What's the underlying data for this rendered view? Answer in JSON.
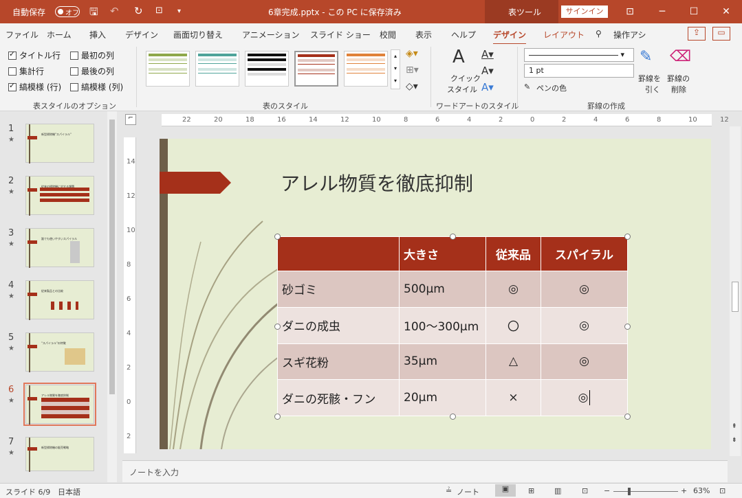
{
  "titlebar": {
    "autosave_label": "自動保存",
    "autosave_state": "オフ",
    "filename": "6章完成.pptx - この PC に保存済み",
    "context_tab_group": "表ツール",
    "signin": "サインイン"
  },
  "tabs": [
    "ファイル",
    "ホーム",
    "挿入",
    "デザイン",
    "画面切り替え",
    "アニメーション",
    "スライド ショー",
    "校閲",
    "表示",
    "ヘルプ",
    "デザイン",
    "レイアウト"
  ],
  "search_label": "操作アシ",
  "ribbon": {
    "options": {
      "header_row": "タイトル行",
      "total_row": "集計行",
      "banded_rows": "縞模様 (行)",
      "first_column": "最初の列",
      "last_column": "最後の列",
      "banded_columns": "縞模様 (列)",
      "group_label": "表スタイルのオプション"
    },
    "styles_group_label": "表のスタイル",
    "wordart": {
      "quick_style_line1": "クイック",
      "quick_style_line2": "スタイル",
      "group_label": "ワードアートのスタイル"
    },
    "borders": {
      "weight": "1 pt",
      "pen_color": "ペンの色",
      "draw_line1": "罫線を",
      "draw_line2": "引く",
      "erase_line1": "罫線の",
      "erase_line2": "削除",
      "group_label": "罫線の作成"
    }
  },
  "hruler_numbers": [
    "22",
    "20",
    "18",
    "16",
    "14",
    "12",
    "10",
    "8",
    "6",
    "4",
    "2",
    "0",
    "2",
    "4",
    "6",
    "8",
    "10",
    "12"
  ],
  "vruler_numbers": [
    "14",
    "12",
    "10",
    "8",
    "6",
    "4",
    "2",
    "0",
    "2"
  ],
  "slides": [
    {
      "num": "1",
      "title": "新型掃除機\"スパイラル\""
    },
    {
      "num": "2",
      "title": "従来の掃除機に対する課題"
    },
    {
      "num": "3",
      "title": "誰でも使いやすいスパイラル"
    },
    {
      "num": "4",
      "title": "従来製品との比較"
    },
    {
      "num": "5",
      "title": "\"スパイラル\"の特徴"
    },
    {
      "num": "6",
      "title": "アレル物質を徹底抑制"
    },
    {
      "num": "7",
      "title": "新型掃除機の販売戦略"
    }
  ],
  "slide": {
    "title": "アレル物質を徹底抑制",
    "table": {
      "headers": [
        "",
        "大きさ",
        "従来品",
        "スパイラル"
      ],
      "rows": [
        [
          "砂ゴミ",
          "500μm",
          "◎",
          "◎"
        ],
        [
          "ダニの成虫",
          "100〜300μm",
          "〇",
          "◎"
        ],
        [
          "スギ花粉",
          "35μm",
          "△",
          "◎"
        ],
        [
          "ダニの死骸・フン",
          "20μm",
          "×",
          "◎"
        ]
      ]
    }
  },
  "notes_placeholder": "ノートを入力",
  "status": {
    "slide_info": "スライド 6/9",
    "language": "日本語",
    "notes": "ノート",
    "zoom": "63%"
  },
  "colors": {
    "accent": "#b7472a",
    "table_header": "#a5301a",
    "slide_bg": "#e7edd3"
  }
}
